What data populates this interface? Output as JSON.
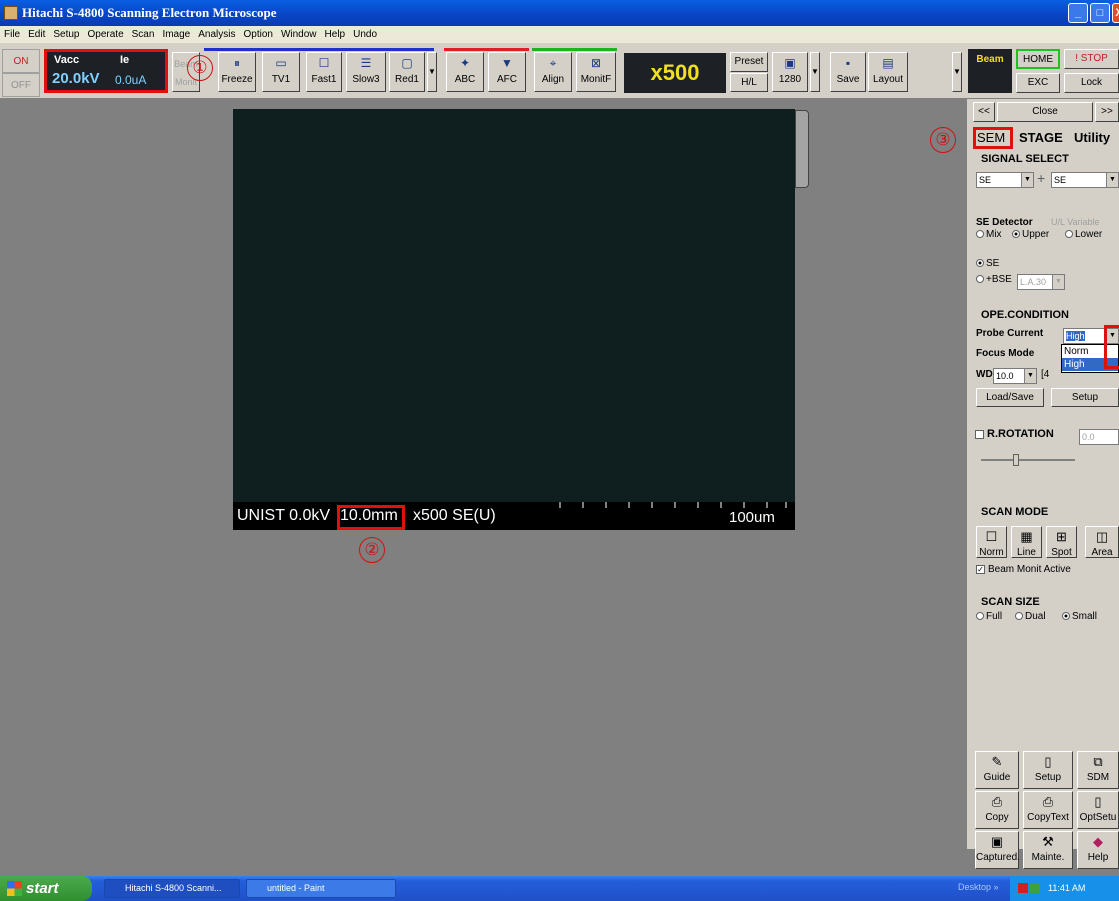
{
  "window": {
    "title": "Hitachi S-4800 Scanning Electron Microscope",
    "min": "_",
    "max": "□",
    "close": "X"
  },
  "menu": [
    "File",
    "Edit",
    "Setup",
    "Operate",
    "Scan",
    "Image",
    "Analysis",
    "Option",
    "Window",
    "Help",
    "Undo"
  ],
  "toolbar": {
    "on": "ON",
    "off": "OFF",
    "vacc_label": "Vacc",
    "ie_label": "Ie",
    "vacc_value": "20.0kV",
    "ie_value": "0.0uA",
    "beam_monit": "Beam Monit",
    "freeze": "Freeze",
    "tv1": "TV1",
    "fast1": "Fast1",
    "slow3": "Slow3",
    "red1": "Red1",
    "abc": "ABC",
    "afc": "AFC",
    "align": "Align",
    "monitf": "MonitF",
    "magnification": "x500",
    "preset": "Preset",
    "hl": "H/L",
    "res": "1280",
    "save": "Save",
    "layout": "Layout",
    "beam": "Beam",
    "home": "HOME",
    "stop": "! STOP",
    "exc": "EXC",
    "lock": "Lock"
  },
  "image": {
    "label": "UNIST 0.0kV",
    "wd": "10.0mm",
    "mag_det": "x500 SE(U)",
    "scale": "100um"
  },
  "annotations": {
    "one": "①",
    "two": "②",
    "three": "③"
  },
  "panel": {
    "nav_left": "<<",
    "close": "Close",
    "nav_right": ">>",
    "tabs": [
      "SEM",
      "STAGE",
      "Utility"
    ],
    "signal_select": "SIGNAL SELECT",
    "signal_left": "SE",
    "signal_right": "SE",
    "se_detector": "SE Detector",
    "ul_variable": "U/L Variable",
    "mix": "Mix",
    "upper": "Upper",
    "lower": "Lower",
    "se": "SE",
    "bse": "+BSE",
    "la": "L.A.30",
    "ope_condition": "OPE.CONDITION",
    "probe_current": "Probe Current",
    "probe_value": "High",
    "probe_options": [
      "Norm",
      "High"
    ],
    "focus_mode": "Focus Mode",
    "wd_label": "WD",
    "wd_value": "10.0",
    "wd_extra": "[4",
    "load_save": "Load/Save",
    "setup": "Setup",
    "rotation": "R.ROTATION",
    "rotation_value": "0.0",
    "scan_mode": "SCAN MODE",
    "scan_modes": [
      "Norm",
      "Line",
      "Spot",
      "Area"
    ],
    "beam_monit_active": "Beam Monit Active",
    "scan_size": "SCAN SIZE",
    "scan_sizes": [
      "Full",
      "Dual",
      "Small"
    ],
    "tools": [
      "Guide",
      "Setup",
      "SDM",
      "Copy",
      "CopyText",
      "OptSetu",
      "Captured.",
      "Mainte.",
      "Help"
    ]
  },
  "taskbar": {
    "start": "start",
    "tasks": [
      "Hitachi S-4800 Scanni...",
      "untitled - Paint"
    ],
    "desktop": "Desktop",
    "chevron": "»",
    "time": "11:41 AM"
  }
}
